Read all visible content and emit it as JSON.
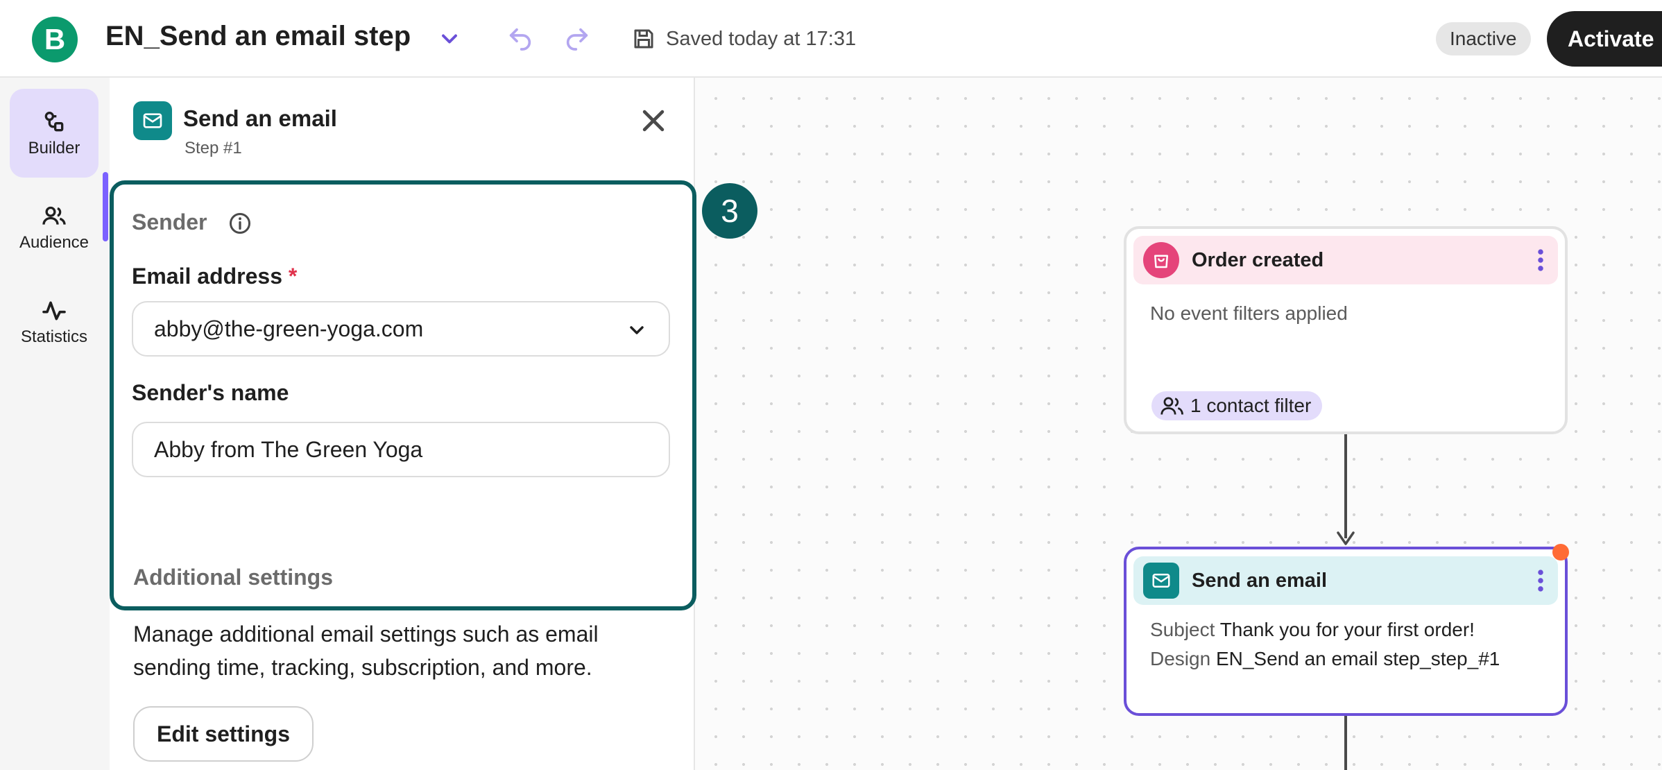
{
  "header": {
    "logo_letter": "B",
    "workflow_title": "EN_Send an email step",
    "saved_status": "Saved today at 17:31",
    "status_badge": "Inactive",
    "activate_label": "Activate"
  },
  "leftnav": {
    "items": [
      {
        "label": "Builder",
        "icon": "builder-icon",
        "active": true
      },
      {
        "label": "Audience",
        "icon": "audience-icon",
        "active": false
      },
      {
        "label": "Statistics",
        "icon": "statistics-icon",
        "active": false
      }
    ]
  },
  "panel": {
    "title": "Send an email",
    "subtitle": "Step #1",
    "sender": {
      "heading": "Sender",
      "email_label": "Email address",
      "required_mark": "*",
      "email_value": "abby@the-green-yoga.com",
      "name_label": "Sender's name",
      "name_value": "Abby from The Green Yoga"
    },
    "additional": {
      "heading": "Additional settings",
      "description": "Manage additional email settings such as email sending time, tracking, subscription, and more.",
      "button_label": "Edit settings"
    }
  },
  "step_badge": "3",
  "canvas": {
    "trigger_node": {
      "title": "Order created",
      "filters_text": "No event filters applied",
      "contact_filter": "1 contact filter"
    },
    "email_node": {
      "title": "Send an email",
      "subject_label": "Subject",
      "subject_value": "Thank you for your first order!",
      "design_label": "Design",
      "design_value": "EN_Send an email step_step_#1"
    }
  },
  "colors": {
    "brand_green": "#0b9a6d",
    "accent_purple": "#7b61ff",
    "teal": "#0f8a8a",
    "highlight_border": "#0b5d5f",
    "trigger_pink": "#e5447a",
    "alert_orange": "#ff6b35"
  }
}
